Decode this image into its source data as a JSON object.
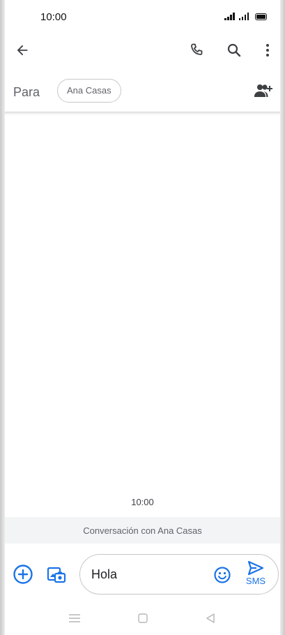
{
  "status": {
    "time": "10:00"
  },
  "app_bar": {
    "icons": [
      "arrow-back-icon",
      "phone-icon",
      "search-icon",
      "more-vert-icon"
    ]
  },
  "to_row": {
    "label": "Para",
    "recipient_chip": "Ana Casas",
    "add_contact_icon": "person-add-icon"
  },
  "conversation": {
    "timestamp": "10:00",
    "banner": "Conversación con Ana Casas"
  },
  "compose": {
    "input_value": "Hola",
    "send_sub_label": "SMS",
    "icons": [
      "add-circle-icon",
      "gallery-icon",
      "emoji-icon",
      "send-icon"
    ]
  },
  "colors": {
    "accent": "#1a73e8",
    "text": "#202124",
    "muted": "#5f6368",
    "banner_bg": "#f3f4f6"
  }
}
